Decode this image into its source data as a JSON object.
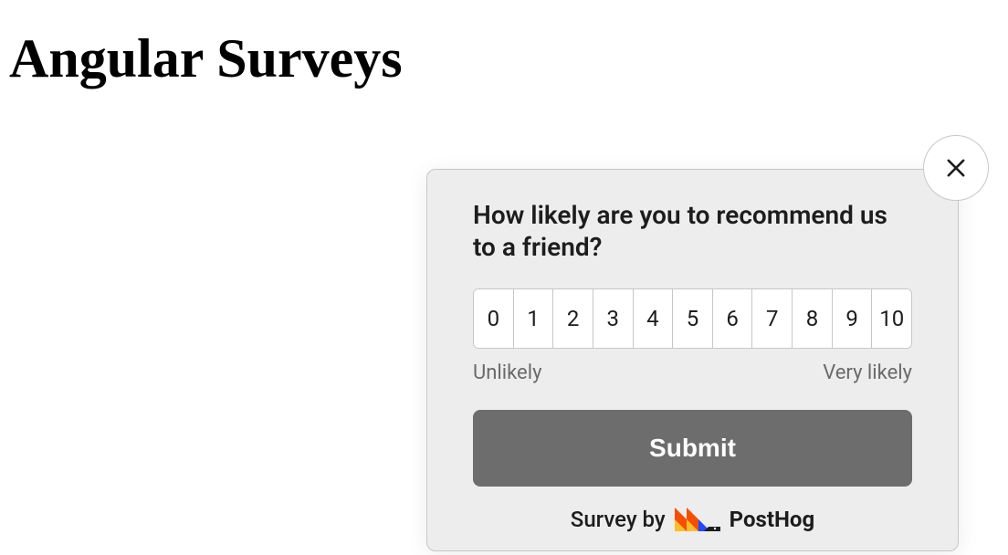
{
  "page": {
    "title": "Angular Surveys"
  },
  "survey": {
    "question": "How likely are you to recommend us to a friend?",
    "ratings": [
      "0",
      "1",
      "2",
      "3",
      "4",
      "5",
      "6",
      "7",
      "8",
      "9",
      "10"
    ],
    "low_label": "Unlikely",
    "high_label": "Very likely",
    "submit_label": "Submit",
    "branding_prefix": "Survey by",
    "branding_name": "PostHog"
  }
}
